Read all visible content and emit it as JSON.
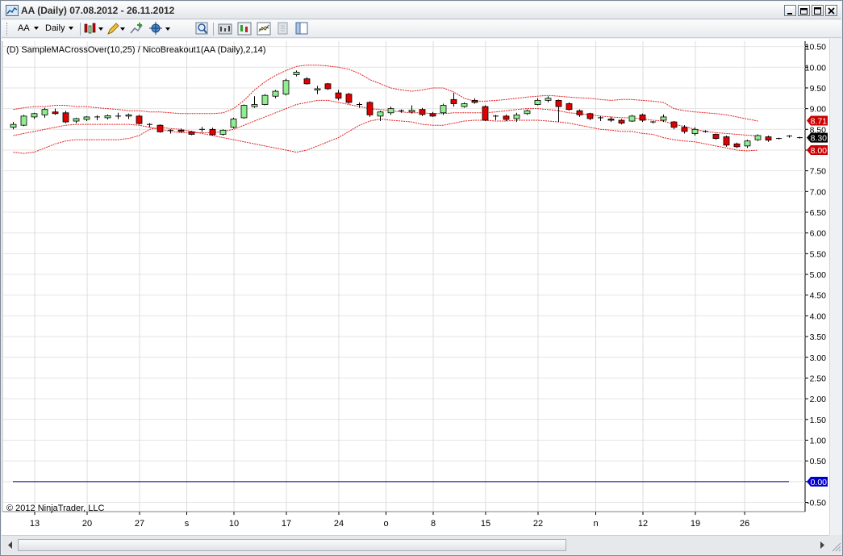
{
  "window": {
    "title": "AA (Daily)  07.08.2012 - 26.11.2012",
    "minimize_icon": "minimize-icon",
    "restore_icon": "restore-icon",
    "close_icon": "close-icon"
  },
  "toolbar": {
    "instrument": "AA",
    "interval": "Daily",
    "icons": [
      "bar-type-icon",
      "pencil-icon",
      "crosshair-icon",
      "zoom-icon",
      "indicators-icon",
      "strategy-icon",
      "data-box-icon",
      "properties-icon"
    ]
  },
  "chart": {
    "label": "(D) SampleMACrossOver(10,25) / NicoBreakout1(AA (Daily),2,14)",
    "copyright": "© 2012 NinjaTrader, LLC",
    "yticks": [
      "10.50",
      "10.00",
      "9.50",
      "9.00",
      "8.50",
      "8.00",
      "7.50",
      "7.00",
      "6.50",
      "6.00",
      "5.50",
      "5.00",
      "4.50",
      "4.00",
      "3.50",
      "3.00",
      "2.50",
      "2.00",
      "1.50",
      "1.00",
      "0.50",
      "0.00",
      "-0.50"
    ],
    "xticks": [
      {
        "label": "13",
        "idx": 2
      },
      {
        "label": "20",
        "idx": 7
      },
      {
        "label": "27",
        "idx": 12
      },
      {
        "label": "s",
        "idx": 16.5
      },
      {
        "label": "10",
        "idx": 21
      },
      {
        "label": "17",
        "idx": 26
      },
      {
        "label": "24",
        "idx": 31
      },
      {
        "label": "o",
        "idx": 35.5
      },
      {
        "label": "8",
        "idx": 40
      },
      {
        "label": "15",
        "idx": 45
      },
      {
        "label": "22",
        "idx": 50
      },
      {
        "label": "n",
        "idx": 55.5
      },
      {
        "label": "12",
        "idx": 60
      },
      {
        "label": "19",
        "idx": 65
      },
      {
        "label": "26",
        "idx": 69.7
      }
    ],
    "price_markers": [
      {
        "label": "8.71",
        "value": 8.71,
        "color": "#cc0000"
      },
      {
        "label": "8.30",
        "value": 8.3,
        "color": "#000000"
      },
      {
        "label": "8.00",
        "value": 8.0,
        "color": "#cc0000"
      },
      {
        "label": "0.00",
        "value": 0.0,
        "color": "#0000cc"
      }
    ],
    "colors": {
      "up": "#90ee90",
      "down": "#e00000",
      "band": "#e02020",
      "zero_line": "#000080"
    }
  },
  "chart_data": {
    "type": "candlestick",
    "ylim": [
      -0.5,
      10.5
    ],
    "candles": [
      {
        "o": 8.55,
        "h": 8.68,
        "l": 8.5,
        "c": 8.62
      },
      {
        "o": 8.6,
        "h": 8.85,
        "l": 8.58,
        "c": 8.82
      },
      {
        "o": 8.8,
        "h": 8.9,
        "l": 8.75,
        "c": 8.88
      },
      {
        "o": 8.85,
        "h": 9.02,
        "l": 8.78,
        "c": 8.98
      },
      {
        "o": 8.92,
        "h": 9.0,
        "l": 8.85,
        "c": 8.88
      },
      {
        "o": 8.9,
        "h": 8.95,
        "l": 8.65,
        "c": 8.68
      },
      {
        "o": 8.7,
        "h": 8.78,
        "l": 8.65,
        "c": 8.76
      },
      {
        "o": 8.74,
        "h": 8.82,
        "l": 8.7,
        "c": 8.8
      },
      {
        "o": 8.78,
        "h": 8.84,
        "l": 8.72,
        "c": 8.8
      },
      {
        "o": 8.78,
        "h": 8.86,
        "l": 8.74,
        "c": 8.83
      },
      {
        "o": 8.8,
        "h": 8.9,
        "l": 8.75,
        "c": 8.82
      },
      {
        "o": 8.82,
        "h": 8.88,
        "l": 8.75,
        "c": 8.85
      },
      {
        "o": 8.82,
        "h": 8.85,
        "l": 8.62,
        "c": 8.64
      },
      {
        "o": 8.62,
        "h": 8.65,
        "l": 8.55,
        "c": 8.6
      },
      {
        "o": 8.6,
        "h": 8.62,
        "l": 8.42,
        "c": 8.44
      },
      {
        "o": 8.46,
        "h": 8.5,
        "l": 8.4,
        "c": 8.48
      },
      {
        "o": 8.48,
        "h": 8.52,
        "l": 8.42,
        "c": 8.45
      },
      {
        "o": 8.44,
        "h": 8.46,
        "l": 8.36,
        "c": 8.38
      },
      {
        "o": 8.48,
        "h": 8.56,
        "l": 8.44,
        "c": 8.5
      },
      {
        "o": 8.5,
        "h": 8.54,
        "l": 8.35,
        "c": 8.37
      },
      {
        "o": 8.38,
        "h": 8.5,
        "l": 8.35,
        "c": 8.48
      },
      {
        "o": 8.55,
        "h": 8.78,
        "l": 8.52,
        "c": 8.75
      },
      {
        "o": 8.78,
        "h": 9.1,
        "l": 8.76,
        "c": 9.08
      },
      {
        "o": 9.05,
        "h": 9.3,
        "l": 9.02,
        "c": 9.1
      },
      {
        "o": 9.1,
        "h": 9.35,
        "l": 9.08,
        "c": 9.32
      },
      {
        "o": 9.3,
        "h": 9.45,
        "l": 9.25,
        "c": 9.42
      },
      {
        "o": 9.35,
        "h": 9.72,
        "l": 9.32,
        "c": 9.68
      },
      {
        "o": 9.82,
        "h": 9.92,
        "l": 9.78,
        "c": 9.88
      },
      {
        "o": 9.72,
        "h": 9.76,
        "l": 9.58,
        "c": 9.6
      },
      {
        "o": 9.45,
        "h": 9.55,
        "l": 9.35,
        "c": 9.48
      },
      {
        "o": 9.6,
        "h": 9.62,
        "l": 9.45,
        "c": 9.48
      },
      {
        "o": 9.38,
        "h": 9.45,
        "l": 9.2,
        "c": 9.25
      },
      {
        "o": 9.35,
        "h": 9.38,
        "l": 9.12,
        "c": 9.15
      },
      {
        "o": 9.1,
        "h": 9.15,
        "l": 9.02,
        "c": 9.08
      },
      {
        "o": 9.15,
        "h": 9.18,
        "l": 8.8,
        "c": 8.85
      },
      {
        "o": 8.82,
        "h": 8.95,
        "l": 8.7,
        "c": 8.92
      },
      {
        "o": 8.9,
        "h": 9.05,
        "l": 8.85,
        "c": 9.0
      },
      {
        "o": 8.95,
        "h": 8.98,
        "l": 8.9,
        "c": 8.93
      },
      {
        "o": 8.92,
        "h": 9.08,
        "l": 8.88,
        "c": 8.96
      },
      {
        "o": 8.98,
        "h": 9.02,
        "l": 8.82,
        "c": 8.86
      },
      {
        "o": 8.88,
        "h": 8.92,
        "l": 8.8,
        "c": 8.82
      },
      {
        "o": 8.9,
        "h": 9.12,
        "l": 8.85,
        "c": 9.08
      },
      {
        "o": 9.22,
        "h": 9.38,
        "l": 9.05,
        "c": 9.12
      },
      {
        "o": 9.05,
        "h": 9.15,
        "l": 9.02,
        "c": 9.12
      },
      {
        "o": 9.2,
        "h": 9.25,
        "l": 9.12,
        "c": 9.15
      },
      {
        "o": 9.05,
        "h": 9.08,
        "l": 8.7,
        "c": 8.72
      },
      {
        "o": 8.82,
        "h": 8.85,
        "l": 8.72,
        "c": 8.8
      },
      {
        "o": 8.82,
        "h": 8.86,
        "l": 8.7,
        "c": 8.74
      },
      {
        "o": 8.76,
        "h": 8.9,
        "l": 8.68,
        "c": 8.85
      },
      {
        "o": 8.88,
        "h": 8.98,
        "l": 8.85,
        "c": 8.95
      },
      {
        "o": 9.1,
        "h": 9.25,
        "l": 9.08,
        "c": 9.2
      },
      {
        "o": 9.2,
        "h": 9.3,
        "l": 9.15,
        "c": 9.25
      },
      {
        "o": 9.2,
        "h": 9.22,
        "l": 8.68,
        "c": 9.05
      },
      {
        "o": 9.12,
        "h": 9.15,
        "l": 8.95,
        "c": 8.98
      },
      {
        "o": 8.95,
        "h": 8.98,
        "l": 8.8,
        "c": 8.85
      },
      {
        "o": 8.88,
        "h": 8.9,
        "l": 8.72,
        "c": 8.76
      },
      {
        "o": 8.78,
        "h": 8.82,
        "l": 8.7,
        "c": 8.76
      },
      {
        "o": 8.75,
        "h": 8.8,
        "l": 8.68,
        "c": 8.72
      },
      {
        "o": 8.72,
        "h": 8.75,
        "l": 8.62,
        "c": 8.65
      },
      {
        "o": 8.7,
        "h": 8.85,
        "l": 8.68,
        "c": 8.82
      },
      {
        "o": 8.85,
        "h": 8.88,
        "l": 8.68,
        "c": 8.72
      },
      {
        "o": 8.68,
        "h": 8.7,
        "l": 8.64,
        "c": 8.66
      },
      {
        "o": 8.72,
        "h": 8.86,
        "l": 8.68,
        "c": 8.8
      },
      {
        "o": 8.68,
        "h": 8.7,
        "l": 8.5,
        "c": 8.55
      },
      {
        "o": 8.55,
        "h": 8.6,
        "l": 8.4,
        "c": 8.45
      },
      {
        "o": 8.4,
        "h": 8.55,
        "l": 8.35,
        "c": 8.5
      },
      {
        "o": 8.44,
        "h": 8.48,
        "l": 8.42,
        "c": 8.45
      },
      {
        "o": 8.38,
        "h": 8.4,
        "l": 8.25,
        "c": 8.28
      },
      {
        "o": 8.32,
        "h": 8.35,
        "l": 8.08,
        "c": 8.12
      },
      {
        "o": 8.15,
        "h": 8.18,
        "l": 8.05,
        "c": 8.08
      },
      {
        "o": 8.1,
        "h": 8.25,
        "l": 8.05,
        "c": 8.22
      },
      {
        "o": 8.25,
        "h": 8.38,
        "l": 8.22,
        "c": 8.35
      },
      {
        "o": 8.32,
        "h": 8.35,
        "l": 8.2,
        "c": 8.24
      },
      {
        "o": 8.28,
        "h": 8.3,
        "l": 8.26,
        "c": 8.28
      },
      {
        "o": 8.32,
        "h": 8.36,
        "l": 8.3,
        "c": 8.34
      },
      {
        "o": 8.3,
        "h": 8.32,
        "l": 8.28,
        "c": 8.3
      }
    ],
    "upper_band": [
      8.98,
      9.02,
      9.05,
      9.05,
      9.08,
      9.08,
      9.05,
      9.05,
      9.02,
      9.0,
      8.98,
      8.95,
      8.95,
      8.92,
      8.92,
      8.9,
      8.88,
      8.88,
      8.88,
      8.88,
      8.9,
      9.0,
      9.2,
      9.45,
      9.65,
      9.8,
      9.92,
      10.02,
      10.05,
      10.05,
      10.03,
      10.0,
      9.95,
      9.85,
      9.7,
      9.6,
      9.5,
      9.45,
      9.42,
      9.45,
      9.5,
      9.5,
      9.4,
      9.25,
      9.18,
      9.18,
      9.2,
      9.22,
      9.25,
      9.28,
      9.3,
      9.32,
      9.3,
      9.28,
      9.26,
      9.25,
      9.22,
      9.2,
      9.22,
      9.22,
      9.2,
      9.18,
      9.15,
      9.0,
      8.95,
      8.92,
      8.9,
      8.88,
      8.85,
      8.8,
      8.75,
      8.7
    ],
    "mid_band": [
      8.35,
      8.4,
      8.45,
      8.5,
      8.55,
      8.6,
      8.62,
      8.62,
      8.62,
      8.62,
      8.62,
      8.62,
      8.6,
      8.55,
      8.5,
      8.45,
      8.42,
      8.42,
      8.42,
      8.42,
      8.45,
      8.5,
      8.6,
      8.7,
      8.8,
      8.9,
      9.0,
      9.1,
      9.15,
      9.2,
      9.2,
      9.15,
      9.1,
      9.05,
      9.0,
      8.98,
      8.95,
      8.92,
      8.9,
      8.9,
      8.88,
      8.88,
      8.9,
      8.9,
      8.9,
      8.9,
      8.92,
      8.95,
      8.98,
      9.0,
      9.0,
      8.98,
      8.95,
      8.9,
      8.88,
      8.85,
      8.82,
      8.8,
      8.78,
      8.78,
      8.75,
      8.72,
      8.7,
      8.62,
      8.57,
      8.5,
      8.45,
      8.42,
      8.4,
      8.38,
      8.36,
      8.34
    ],
    "lower_band": [
      7.95,
      7.92,
      7.95,
      8.05,
      8.15,
      8.22,
      8.25,
      8.25,
      8.25,
      8.25,
      8.25,
      8.28,
      8.35,
      8.5,
      8.55,
      8.52,
      8.5,
      8.45,
      8.4,
      8.35,
      8.3,
      8.25,
      8.2,
      8.15,
      8.1,
      8.05,
      8.0,
      7.95,
      8.0,
      8.1,
      8.2,
      8.3,
      8.45,
      8.6,
      8.7,
      8.75,
      8.72,
      8.7,
      8.68,
      8.62,
      8.6,
      8.6,
      8.65,
      8.7,
      8.72,
      8.72,
      8.7,
      8.7,
      8.72,
      8.72,
      8.72,
      8.7,
      8.68,
      8.65,
      8.6,
      8.55,
      8.5,
      8.48,
      8.45,
      8.45,
      8.4,
      8.38,
      8.3,
      8.25,
      8.22,
      8.2,
      8.15,
      8.1,
      8.05,
      8.0,
      7.98,
      8.0
    ],
    "zero_line": 0.0
  }
}
